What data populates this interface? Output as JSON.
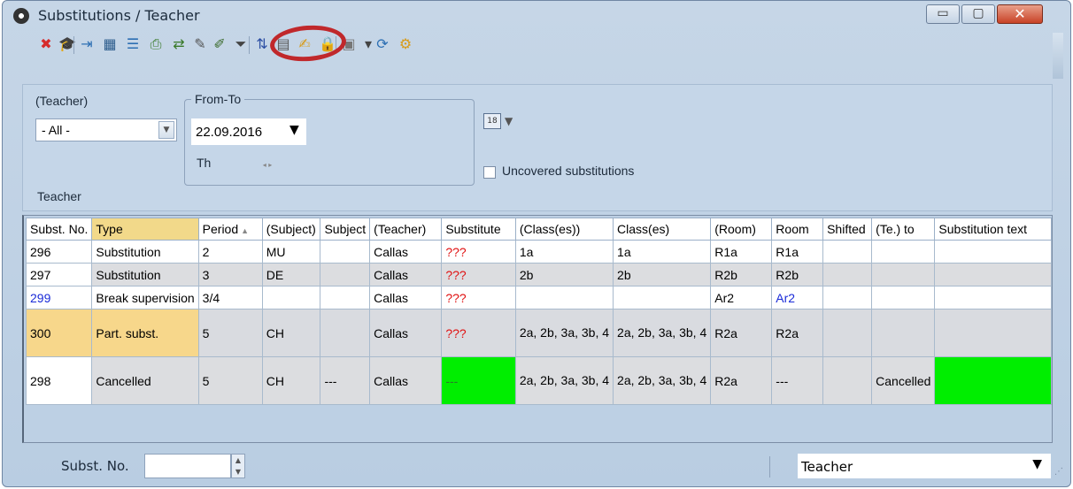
{
  "window": {
    "title": "Substitutions / Teacher",
    "controls": {
      "minimize": "▭",
      "maximize": "▢",
      "close": "✕"
    }
  },
  "toolbar": {
    "buttons": [
      {
        "name": "delete-icon",
        "glyph": "✖",
        "color": "#d62b2b"
      },
      {
        "name": "teacher-hat-icon",
        "glyph": "🎓",
        "color": "#222"
      },
      {
        "name": "import-icon",
        "glyph": "⇥",
        "color": "#2d6fb3"
      },
      {
        "name": "calculator-icon",
        "glyph": "▦",
        "color": "#2c5c8c"
      },
      {
        "name": "list-icon",
        "glyph": "☰",
        "color": "#2d6fb3"
      },
      {
        "name": "print-icon",
        "glyph": "⎙",
        "color": "#3a7a2a"
      },
      {
        "name": "export-icon",
        "glyph": "⇄",
        "color": "#3a7a2a"
      },
      {
        "name": "filter-pen-icon",
        "glyph": "✎",
        "color": "#555"
      },
      {
        "name": "auto-substitution-icon",
        "glyph": "✐",
        "color": "#3a6a2a"
      },
      {
        "name": "funnel-icon",
        "glyph": "⏷",
        "color": "#444"
      },
      {
        "name": "sort-icon",
        "glyph": "⇅",
        "color": "#2d4fa3"
      },
      {
        "name": "table-icon",
        "glyph": "▤",
        "color": "#555"
      },
      {
        "name": "edit-icon",
        "glyph": "✍",
        "color": "#d79b1a"
      },
      {
        "name": "lock-icon",
        "glyph": "🔒",
        "color": "#c98a0c"
      },
      {
        "name": "report-icon",
        "glyph": "▣",
        "color": "#777"
      },
      {
        "name": "dropdown-icon",
        "glyph": "▾",
        "color": "#444"
      },
      {
        "name": "refresh-icon",
        "glyph": "⟳",
        "color": "#2d6fb3"
      },
      {
        "name": "settings-gear-icon",
        "glyph": "⚙",
        "color": "#d79b1a"
      }
    ]
  },
  "filters": {
    "teacher_label": "(Teacher)",
    "teacher_value": "- All -",
    "fromto_label": "From-To",
    "date_value": "22.09.2016",
    "day_label": "Th",
    "spin_glyph": "◂ ▸",
    "calendar_glyph": "18",
    "uncovered_label": "Uncovered substitutions",
    "caption": "Teacher"
  },
  "grid": {
    "columns": [
      "Subst. No.",
      "Type",
      "Period",
      "(Subject)",
      "Subject",
      "(Teacher)",
      "Substitute",
      "(Class(es))",
      "Class(es)",
      "(Room)",
      "Room",
      "Shifted",
      "(Te.) to",
      "Substitution text"
    ],
    "period_sort_glyph": "▲",
    "rows": [
      [
        "296",
        "Substitution",
        "2",
        "MU",
        "",
        "Callas",
        "???",
        "1a",
        "1a",
        "R1a",
        "R1a",
        "",
        "",
        ""
      ],
      [
        "297",
        "Substitution",
        "3",
        "DE",
        "",
        "Callas",
        "???",
        "2b",
        "2b",
        "R2b",
        "R2b",
        "",
        "",
        ""
      ],
      [
        "299",
        "Break supervision",
        "3/4",
        "",
        "",
        "Callas",
        "???",
        "",
        "",
        "Ar2",
        "Ar2",
        "",
        "",
        ""
      ],
      [
        "300",
        "Part. subst.",
        "5",
        "CH",
        "",
        "Callas",
        "???",
        "2a, 2b, 3a, 3b, 4",
        "2a, 2b, 3a, 3b, 4",
        "R2a",
        "R2a",
        "",
        "",
        ""
      ],
      [
        "298",
        "Cancelled",
        "5",
        "CH",
        "---",
        "Callas",
        "---",
        "2a, 2b, 3a, 3b, 4",
        "2a, 2b, 3a, 3b, 4",
        "R2a",
        "---",
        "",
        "Cancelled",
        ""
      ]
    ]
  },
  "statusbar": {
    "subst_label": "Subst. No.",
    "subst_value": "",
    "view_value": "Teacher",
    "arrow": "▼",
    "grip": "⋰"
  },
  "colors": {
    "highlight_ring": "#c0282b",
    "unassigned_text": "#e01010",
    "green_cell": "#00ee00",
    "selected_cell": "#f7d78b"
  }
}
